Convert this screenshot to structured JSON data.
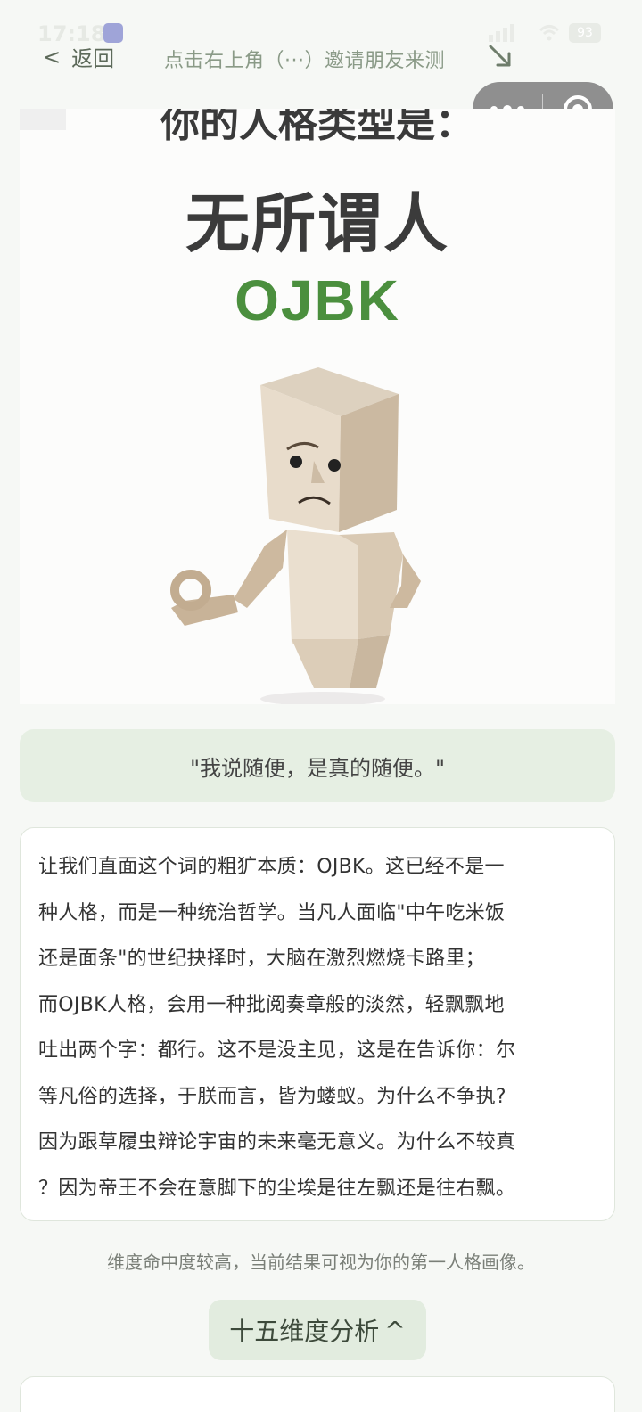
{
  "status_bar": {
    "time": "17:18",
    "battery": "93"
  },
  "nav": {
    "back_label": "返回",
    "back_chevron": "<",
    "invite_hint": "点击右上角（···）邀请朋友来测"
  },
  "hero": {
    "prefix": "你的人格类型是：",
    "title": "无所谓人",
    "code": "OJBK"
  },
  "quote": "\"我说随便，是真的随便。\"",
  "description": {
    "lines": [
      "让我们直面这个词的粗犷本质：OJBK。这已经不是一",
      "种人格，而是一种统治哲学。当凡人面临\"中午吃米饭",
      "还是面条\"的世纪抉择时，大脑在激烈燃烧卡路里；",
      "而OJBK人格，会用一种批阅奏章般的淡然，轻飘飘地",
      "吐出两个字：都行。这不是没主见，这是在告诉你：尔",
      "等凡俗的选择，于朕而言，皆为蝼蚁。为什么不争执?",
      "因为跟草履虫辩论宇宙的未来毫无意义。为什么不较真",
      "？因为帝王不会在意脚下的尘埃是往左飘还是往右飘。"
    ]
  },
  "note": "维度命中度较高，当前结果可视为你的第一人格画像。",
  "analysis_button": {
    "label": "十五维度分析",
    "caret": "^"
  },
  "colors": {
    "accent_green": "#4b8f3e",
    "quote_bg": "#e6efe3",
    "page_bg": "#f6f8f5"
  },
  "icons": {
    "back": "chevron-left-icon",
    "invite_arrow": "arrow-down-right-icon",
    "more": "more-dots-icon",
    "close": "target-icon"
  }
}
